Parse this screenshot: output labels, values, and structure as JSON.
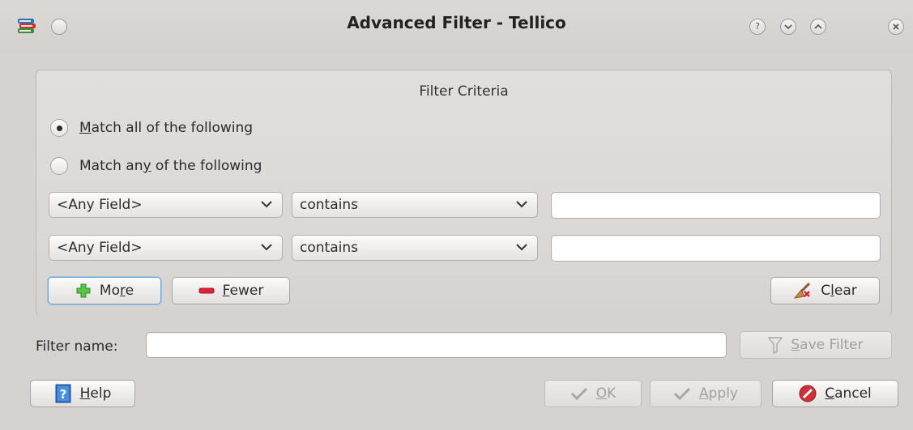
{
  "window": {
    "title": "Advanced Filter - Tellico"
  },
  "criteria": {
    "group_title": "Filter Criteria",
    "match_all": {
      "prefix": "",
      "mnemonic": "M",
      "suffix": "atch all of the following",
      "checked": true
    },
    "match_any": {
      "prefix": "Match an",
      "mnemonic": "y",
      "suffix": " of the following",
      "checked": false
    },
    "rules": [
      {
        "field": "<Any Field>",
        "operator": "contains",
        "value": ""
      },
      {
        "field": "<Any Field>",
        "operator": "contains",
        "value": ""
      }
    ],
    "more_button": {
      "prefix": "Mo",
      "mnemonic": "r",
      "suffix": "e"
    },
    "fewer_button": {
      "prefix": "",
      "mnemonic": "F",
      "suffix": "ewer"
    },
    "clear_button": {
      "prefix": "C",
      "mnemonic": "l",
      "suffix": "ear"
    }
  },
  "filter_name": {
    "label": "Filter name:",
    "value": "",
    "save_button": {
      "prefix": "",
      "mnemonic": "S",
      "suffix": "ave Filter",
      "enabled": false
    }
  },
  "footer": {
    "help_button": {
      "prefix": "",
      "mnemonic": "H",
      "suffix": "elp"
    },
    "ok_button": {
      "prefix": "",
      "mnemonic": "O",
      "suffix": "K",
      "enabled": false
    },
    "apply_button": {
      "prefix": "",
      "mnemonic": "A",
      "suffix": "pply",
      "enabled": false
    },
    "cancel_button": {
      "prefix": "",
      "mnemonic": "C",
      "suffix": "ancel",
      "enabled": true
    }
  },
  "colors": {
    "focus_border": "#6fa6d6",
    "add_icon": "#4caf3a",
    "remove_icon": "#d6203a",
    "cancel_icon": "#d0303a"
  },
  "icons": [
    "tellico-app-icon",
    "help-icon",
    "minimize-icon",
    "maximize-icon",
    "close-icon",
    "plus-icon",
    "minus-icon",
    "clear-broom-icon",
    "filter-funnel-icon",
    "help-book-icon",
    "check-icon",
    "cancel-icon"
  ]
}
